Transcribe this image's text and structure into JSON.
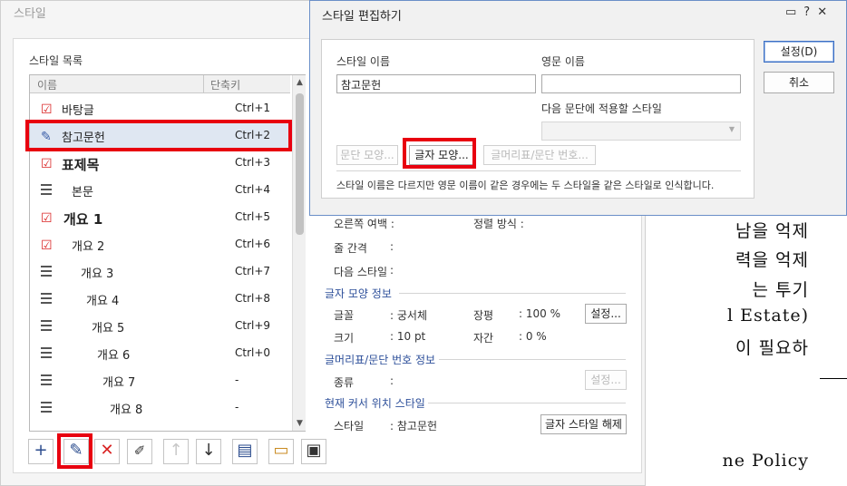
{
  "background_doc": {
    "lines": [
      "남을 억제",
      "력을 억제",
      "는   투기",
      "l Estate)",
      "이 필요하",
      "ne Policy"
    ]
  },
  "style_dialog": {
    "title": "스타일",
    "list_label": "스타일 목록",
    "columns": {
      "name": "이름",
      "shortcut": "단축키"
    },
    "rows": [
      {
        "name": "바탕글",
        "shortcut": "Ctrl+1",
        "icon": "check-icon"
      },
      {
        "name": "참고문헌",
        "shortcut": "Ctrl+2",
        "icon": "pen-icon",
        "selected": true
      },
      {
        "name": "표제목",
        "shortcut": "Ctrl+3",
        "icon": "check-icon"
      },
      {
        "name": "본문",
        "shortcut": "Ctrl+4",
        "icon": "paragraph-icon"
      },
      {
        "name": "개요 1",
        "shortcut": "Ctrl+5",
        "icon": "check-icon"
      },
      {
        "name": "개요 2",
        "shortcut": "Ctrl+6",
        "icon": "check-icon"
      },
      {
        "name": "개요 3",
        "shortcut": "Ctrl+7",
        "icon": "paragraph-icon"
      },
      {
        "name": "개요 4",
        "shortcut": "Ctrl+8",
        "icon": "paragraph-icon"
      },
      {
        "name": "개요 5",
        "shortcut": "Ctrl+9",
        "icon": "paragraph-icon"
      },
      {
        "name": "개요 6",
        "shortcut": "Ctrl+0",
        "icon": "paragraph-icon"
      },
      {
        "name": "개요 7",
        "shortcut": "-",
        "icon": "paragraph-icon"
      },
      {
        "name": "개요 8",
        "shortcut": "-",
        "icon": "paragraph-icon"
      }
    ],
    "toolbar": [
      "add-icon",
      "edit-icon",
      "delete-icon",
      "replace-icon",
      "move-up-icon",
      "move-down-icon",
      "import-icon",
      "open-folder-icon",
      "save-icon"
    ],
    "info": {
      "right_margin": "오른쪽 여백 :",
      "align": "정렬 방식 :",
      "line_spacing": "줄 간격",
      "next_style": "다음 스타일",
      "colon": ":",
      "char_section": "글자 모양 정보",
      "font_label": "글꼴",
      "font_value": ": 궁서체",
      "ratio_label": "장평",
      "ratio_value": ": 100 %",
      "size_label": "크기",
      "size_value": ": 10 pt",
      "spacing_label": "자간",
      "spacing_value": ": 0 %",
      "setting_btn": "설정...",
      "bullet_section": "글머리표/문단 번호 정보",
      "kind_label": "종류",
      "cursor_section": "현재 커서 위치 스타일",
      "style_label": "스타일",
      "style_value": ": 참고문헌",
      "release_btn": "글자 스타일 해제"
    }
  },
  "edit_dialog": {
    "title": "스타일 편집하기",
    "name_label": "스타일 이름",
    "name_value": "참고문헌",
    "eng_label": "영문 이름",
    "eng_value": "",
    "next_label": "다음 문단에 적용할 스타일",
    "para_btn": "문단 모양...",
    "char_btn": "글자 모양...",
    "bullet_btn": "글머리표/문단 번호...",
    "note": "스타일 이름은 다르지만 영문 이름이 같은 경우에는 두 스타일을 같은 스타일로 인식합니다.",
    "ok_btn": "설정(D)",
    "cancel_btn": "취소"
  },
  "colors": {
    "highlight": "#e8000f",
    "section_heading": "#2d4f9a",
    "check": "#d92323"
  }
}
